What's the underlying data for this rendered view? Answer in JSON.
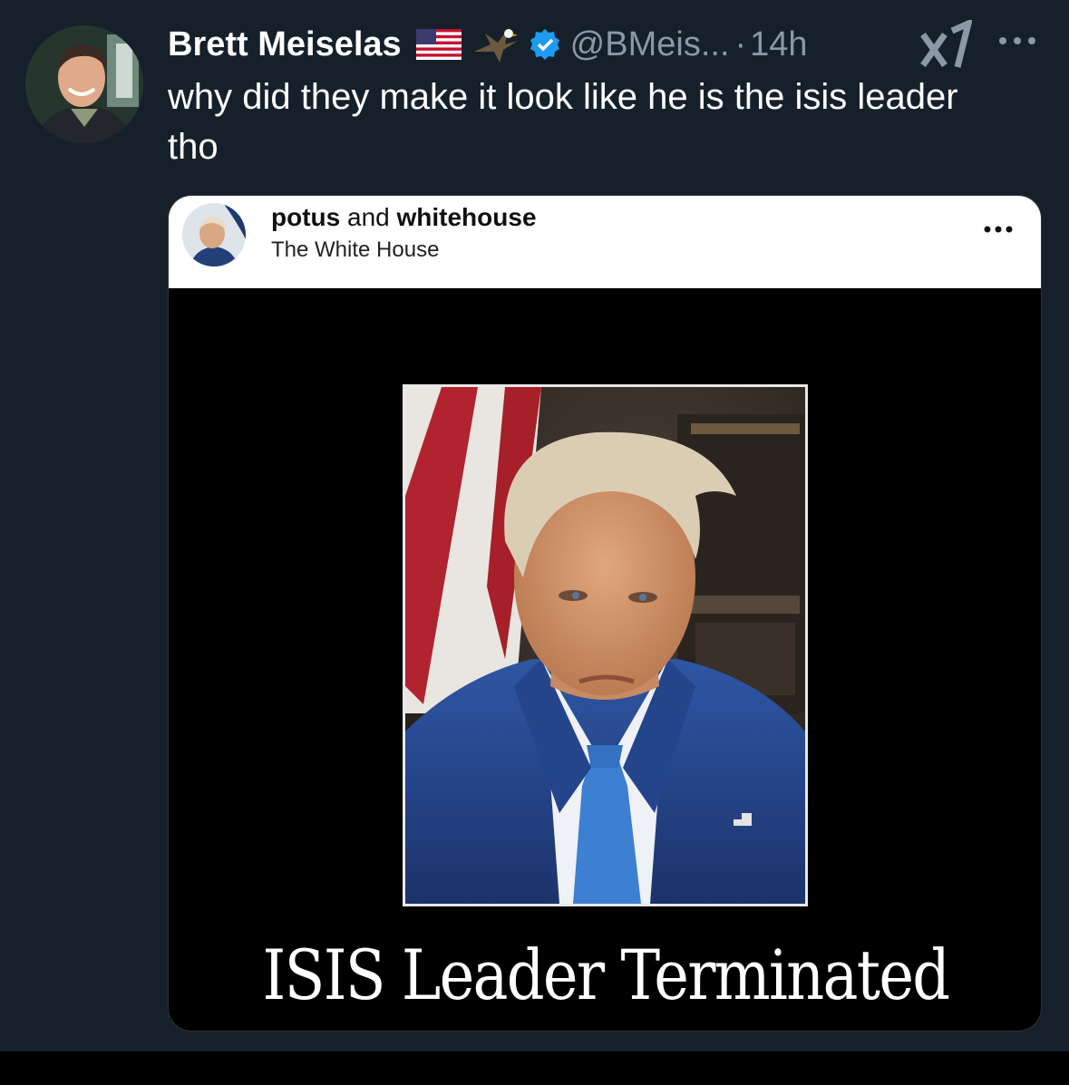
{
  "tweet": {
    "author_name": "Brett Meiselas",
    "handle": "@BMeis...",
    "separator": "·",
    "time": "14h",
    "text": "why did they make it look like he is the isis leader tho"
  },
  "embedded_post": {
    "title_part1": "potus",
    "title_part2": " and ",
    "title_part3": "whitehouse",
    "subtitle": "The White House",
    "caption": "ISIS Leader Terminated"
  },
  "icons": [
    "us-flag-icon",
    "eagle-icon",
    "verified-badge-icon",
    "grok-icon",
    "more-icon"
  ],
  "colors": {
    "background": "#15202b",
    "verified": "#1d9bf0",
    "muted_text": "#8b98a5"
  }
}
